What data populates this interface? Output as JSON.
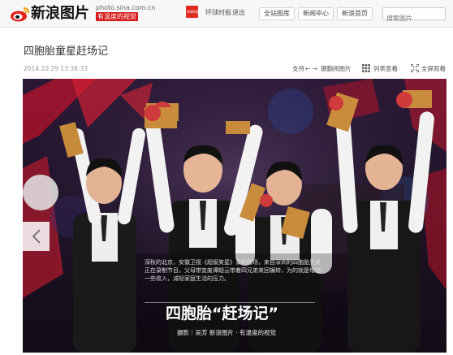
{
  "header": {
    "logo_text": "新浪图片",
    "domain": "photo.sina.com.cn",
    "slogan": "有温度的视觉",
    "badge_text": "环球时报",
    "links": [
      "环球时报",
      "退出"
    ],
    "nav": [
      "全站图库",
      "新闻中心",
      "新浪首页"
    ],
    "search_placeholder": "搜索图片"
  },
  "article": {
    "title": "四胞胎童星赶场记",
    "date": "2014.10.29 13:38:33"
  },
  "toolbar": {
    "support_label": "支持",
    "support_arrows": "← →",
    "support_suffix": "键翻阅图片",
    "list_view": "列表查看",
    "fullscreen": "全屏观看"
  },
  "caption": {
    "body": "深秋的北京，安徽卫视《超级笑星》录制现场，来自深圳的四胞胎兄弟正在录制节目，父母带变废谭超云带着四兄弟来回辗转，为的就是增加一些收入，减轻家庭生活的压力。",
    "headline": "四胞胎“赶场记”",
    "credit": "摄影｜吴芳    新浪图片 · 有温度的视觉"
  },
  "colors": {
    "brand_red": "#d71718",
    "header_bg": "#f7f7f7",
    "photo_bg": "#1a1021"
  },
  "icons": [
    "sina-eye-logo-icon",
    "grid-view-icon",
    "fullscreen-icon",
    "chevron-left-icon"
  ]
}
